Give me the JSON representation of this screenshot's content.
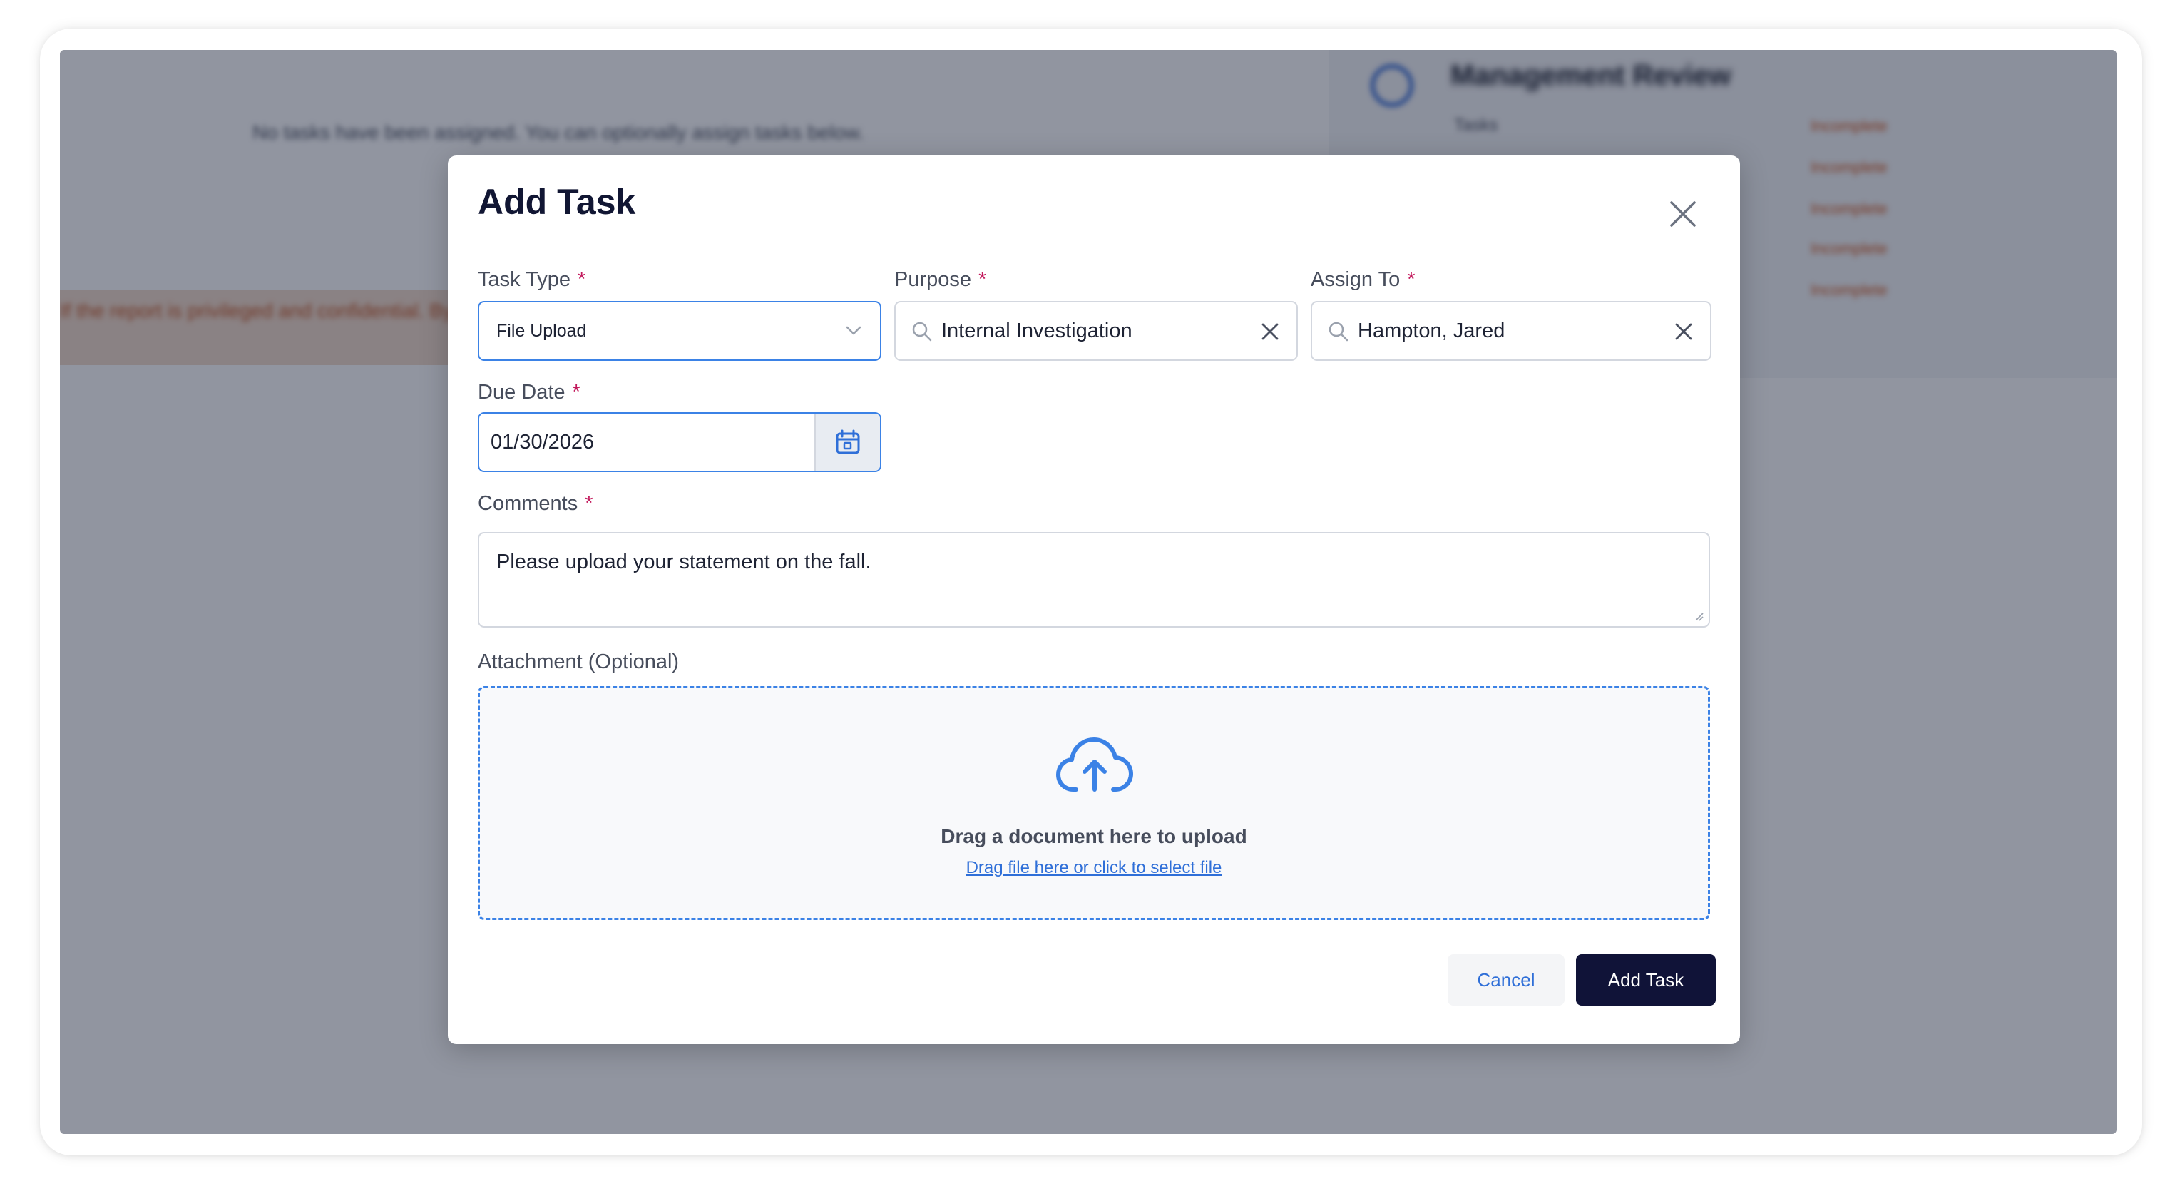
{
  "background": {
    "note": "No tasks have been assigned. You can optionally assign tasks below.",
    "banner": "If the report is privileged and confidential. By",
    "panel_title": "Management Review",
    "panel_label": "Tasks",
    "status_items": [
      "Incomplete",
      "Incomplete",
      "Incomplete",
      "Incomplete",
      "Incomplete"
    ]
  },
  "modal": {
    "title": "Add Task",
    "task_type": {
      "label": "Task Type",
      "value": "File Upload"
    },
    "purpose": {
      "label": "Purpose",
      "value": "Internal Investigation"
    },
    "assign_to": {
      "label": "Assign To",
      "value": "Hampton, Jared"
    },
    "due_date": {
      "label": "Due Date",
      "value": "01/30/2026"
    },
    "comments": {
      "label": "Comments",
      "value": "Please upload your statement on the fall."
    },
    "attachment": {
      "label": "Attachment (Optional)",
      "main_text": "Drag a document here to upload",
      "link_text": "Drag file here or click to select file"
    },
    "required_marker": "*",
    "cancel_label": "Cancel",
    "submit_label": "Add Task"
  },
  "colors": {
    "accent": "#3b82e6",
    "primary_button": "#101338",
    "required": "#c2185b",
    "link": "#2f6fd8"
  },
  "icons": {
    "close": "close-icon",
    "dropdown": "chevron-down-icon",
    "search": "search-icon",
    "clear": "clear-icon",
    "calendar": "calendar-icon",
    "upload": "cloud-upload-icon"
  }
}
